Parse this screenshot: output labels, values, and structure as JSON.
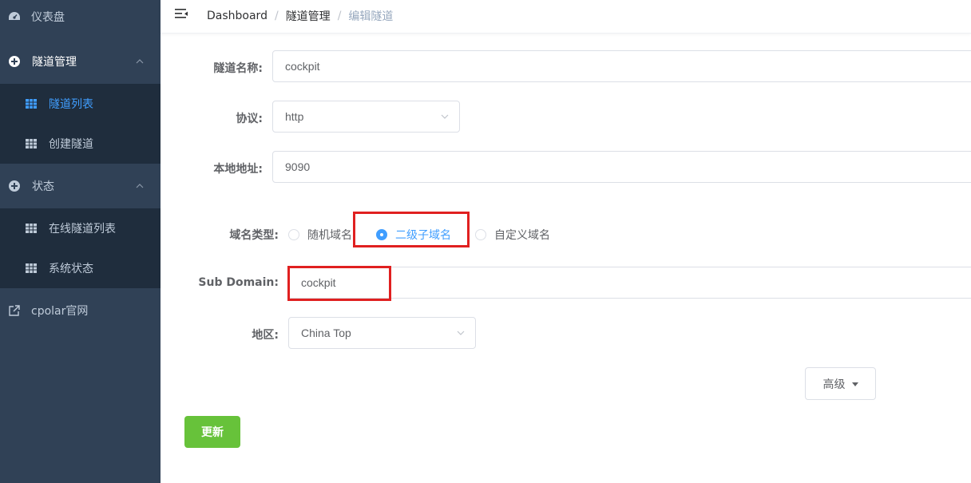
{
  "sidebar": {
    "dashboard": "仪表盘",
    "tunnel_mgmt": "隧道管理",
    "tunnel_list": "隧道列表",
    "create_tunnel": "创建隧道",
    "status": "状态",
    "online_tunnels": "在线隧道列表",
    "system_status": "系统状态",
    "cpolar_site": "cpolar官网"
  },
  "breadcrumb": {
    "root": "Dashboard",
    "parent": "隧道管理",
    "current": "编辑隧道",
    "separator": "/"
  },
  "form": {
    "name_label": "隧道名称:",
    "name_value": "cockpit",
    "protocol_label": "协议:",
    "protocol_value": "http",
    "local_addr_label": "本地地址:",
    "local_addr_value": "9090",
    "domain_type_label": "域名类型:",
    "domain_options": [
      "随机域名",
      "二级子域名",
      "自定义域名"
    ],
    "domain_selected": "二级子域名",
    "subdomain_label": "Sub Domain:",
    "subdomain_value": "cockpit",
    "region_label": "地区:",
    "region_value": "China Top",
    "advanced_button": "高级",
    "update_button": "更新"
  },
  "colors": {
    "sidebar_bg": "#304156",
    "submenu_bg": "#1f2d3d",
    "accent": "#409eff",
    "update_button": "#67c23a",
    "highlight": "#e02020"
  }
}
